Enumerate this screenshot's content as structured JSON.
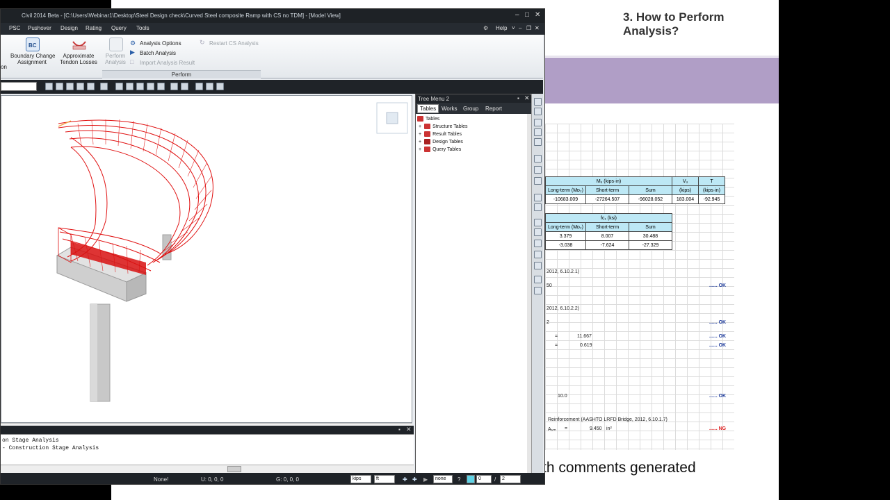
{
  "app": {
    "title": "Civil 2014 Beta - [C:\\Users\\Webinar1\\Desktop\\Steel Design check\\Curved Steel composite Ramp with CS no TDM] - [Model View]",
    "menus": [
      "PSC",
      "Pushover",
      "Design",
      "Rating",
      "Query",
      "Tools"
    ],
    "help": "Help"
  },
  "ribbon": {
    "partial_left": "on",
    "boundary_change": "Boundary Change\nAssignment",
    "tendon_losses": "Approximate\nTendon Losses",
    "perform_analysis": "Perform\nAnalysis",
    "analysis_options": "Analysis Options",
    "batch_analysis": "Batch Analysis",
    "import_result": "Import Analysis Result",
    "restart_cs": "Restart CS Analysis",
    "group_label": "Perform"
  },
  "messages": {
    "line1": "on Stage Analysis",
    "line2": "- Construction Stage Analysis"
  },
  "status": {
    "none": "None!",
    "u": "U: 0, 0, 0",
    "g": "G: 0, 0, 0",
    "force_unit": "kips",
    "length_unit": "ft",
    "filter": "none",
    "page_current": "0",
    "page_sep": "/",
    "page_total": "2"
  },
  "tree": {
    "title": "Tree Menu 2",
    "tabs": [
      "Tables",
      "Works",
      "Group",
      "Report"
    ],
    "root": "Tables",
    "items": [
      "Structure Tables",
      "Result Tables",
      "Design Tables",
      "Query Tables"
    ]
  },
  "slide": {
    "title": "3. How to Perform Analysis?",
    "caption": "th comments generated"
  },
  "sheet": {
    "table1": {
      "mu_header": "Mᵤ (kips·in)",
      "vu_header": "Vᵤ",
      "vu_unit": "(kips)",
      "t_header": "T",
      "t_unit": "(kips·in)",
      "cols": [
        "Long-term (Mᴅ₂)",
        "Short-term",
        "Sum"
      ],
      "values": [
        "-10683.009",
        "-27264.507",
        "-96028.052",
        "183.004",
        "-92.945"
      ]
    },
    "table2": {
      "header": "fᴄ₁ (ksi)",
      "cols": [
        "Long-term (Mᴅ₂)",
        "Short-term",
        "Sum"
      ],
      "row1": [
        "3.379",
        "8.007",
        "30.488"
      ],
      "row2": [
        "-3.038",
        "-7.624",
        "-27.329"
      ]
    },
    "ref1": "2012, 6.10.2.1)",
    "ref2": "2012, 6.10.2.2)",
    "v1": "50",
    "v2": "2",
    "eq1": "=",
    "val1": "11.667",
    "eq2": "=",
    "val2": "0.619",
    "v3": "10.0",
    "ref3": "Reinforcement (AASHTO LRFD Bridge, 2012, 6.10.1.7)",
    "aswm": "Aₛₘ",
    "eq3": "=",
    "val3": "9.450",
    "unit3": "in²",
    "ok": "...... OK",
    "ng": "...... NG"
  }
}
